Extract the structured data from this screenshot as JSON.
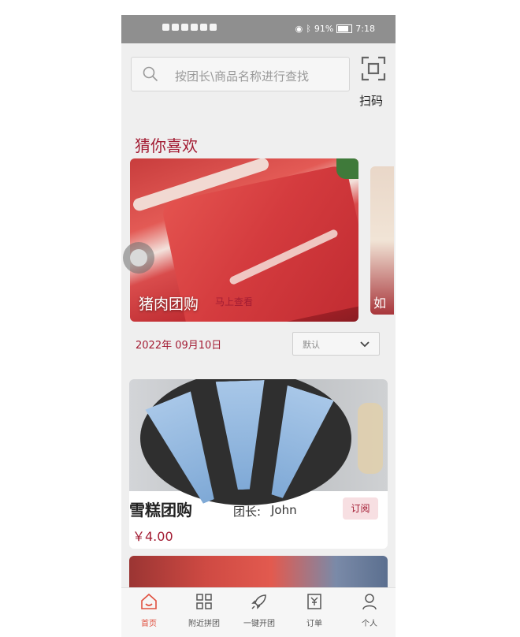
{
  "status_bar": {
    "battery": "91%",
    "time": "7:18"
  },
  "search": {
    "placeholder": "按团长\\商品名称进行查找"
  },
  "scan": {
    "label": "扫码"
  },
  "recommend": {
    "title": "猜你喜欢",
    "slide_caption": "猪肉团购",
    "slide_link": "马上查看",
    "next_slide_caption": "如"
  },
  "filter": {
    "date": "2022年 09月10日",
    "sort_value": "默认"
  },
  "products": [
    {
      "name": "雪糕团购",
      "leader_label": "团长:",
      "leader_name": "John",
      "subscribe_label": "订阅",
      "price": "￥4.00"
    }
  ],
  "tabbar": {
    "items": [
      {
        "label": "首页",
        "icon": "home-icon",
        "active": true
      },
      {
        "label": "附近拼团",
        "icon": "grid-icon",
        "active": false
      },
      {
        "label": "一键开团",
        "icon": "rocket-icon",
        "active": false
      },
      {
        "label": "订单",
        "icon": "order-icon",
        "active": false
      },
      {
        "label": "个人",
        "icon": "user-icon",
        "active": false
      }
    ]
  },
  "colors": {
    "accent": "#a31c33",
    "tab_active": "#e0503f"
  }
}
